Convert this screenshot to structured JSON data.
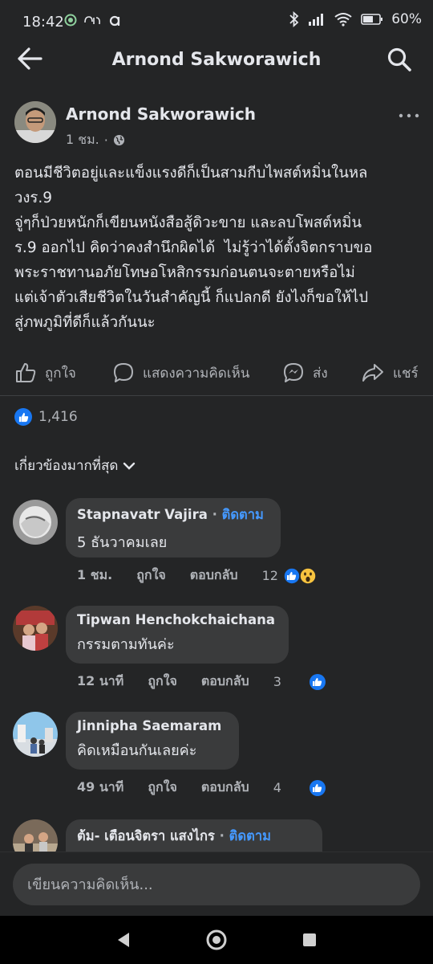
{
  "status": {
    "time": "18:42",
    "battery": "60%"
  },
  "header": {
    "title": "Arnond Sakworawich"
  },
  "post": {
    "author": "Arnond Sakworawich",
    "time": "1 ชม.",
    "body": "ตอนมีชีวิตอยู่และแข็งแรงดีก็เป็นสามกีบไพสต์หมิ่นในหล\nวงร.9\nจู่ๆก็ป่วยหนักก็เขียนหนังสือสู้ดิวะขาย และลบโพสต์หมิ่น\nร.9 ออกไป คิดว่าคงสำนึกผิดได้  ไม่รู้ว่าได้ตั้งจิตกราบขอ\nพระราชทานอภัยโทษอโหสิกรรมก่อนตนจะตายหรือไม่\nแต่เจ้าตัวเสียชีวิตในวันสำคัญนี้ ก็แปลกดี ยังไงก็ขอให้ไป\nสู่ภพภูมิที่ดีก็แล้วกันนะ"
  },
  "actions": {
    "like": "ถูกใจ",
    "comment": "แสดงความคิดเห็น",
    "send": "ส่ง",
    "share": "แชร์"
  },
  "reactions": {
    "count": "1,416"
  },
  "sort": {
    "label": "เกี่ยวข้องมากที่สุด"
  },
  "comments": [
    {
      "name": "Stapnavatr Vajira",
      "follow": "ติดตาม",
      "text": "5 ธันวาคมเลย",
      "time": "1 ชม.",
      "like": "ถูกใจ",
      "reply": "ตอบกลับ",
      "count": "12"
    },
    {
      "name": "Tipwan Henchokchaichana",
      "text": "กรรมตามทันค่ะ",
      "time": "12 นาที",
      "like": "ถูกใจ",
      "reply": "ตอบกลับ",
      "count": "3"
    },
    {
      "name": "Jinnipha Saemaram",
      "text": "คิดเหมือนกันเลยค่ะ",
      "time": "49 นาที",
      "like": "ถูกใจ",
      "reply": "ตอบกลับ",
      "count": "4"
    },
    {
      "name": "ต้ม- เตือนจิตรา แสงไกร",
      "follow": "ติดตาม"
    }
  ],
  "composer": {
    "placeholder": "เขียนความคิดเห็น..."
  },
  "colors": {
    "background": "#242526",
    "bubble": "#3a3b3c",
    "accent": "#1877f2",
    "follow": "#4599ff"
  }
}
